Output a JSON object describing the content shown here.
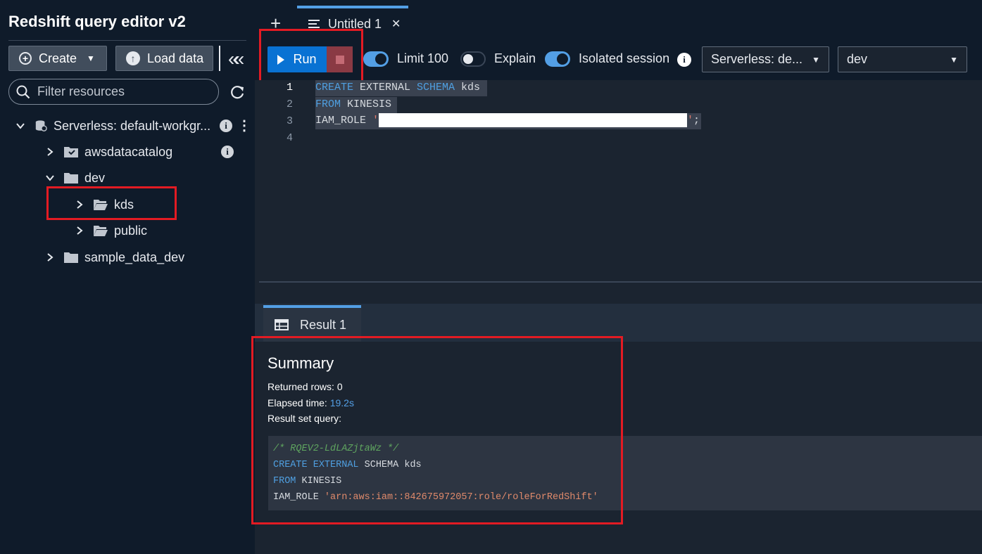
{
  "sidebar": {
    "title": "Redshift query editor v2",
    "create_label": "Create",
    "load_label": "Load data",
    "filter_placeholder": "Filter resources",
    "tree": {
      "workgroup": "Serverless: default-workgr...",
      "awsdatacatalog": "awsdatacatalog",
      "dev": "dev",
      "kds": "kds",
      "public": "public",
      "sample_data_dev": "sample_data_dev"
    }
  },
  "tabs": {
    "untitled": "Untitled 1"
  },
  "toolbar": {
    "run_label": "Run",
    "limit_label": "Limit 100",
    "limit_on": true,
    "explain_label": "Explain",
    "explain_on": false,
    "isolated_label": "Isolated session",
    "isolated_on": true,
    "connection_select": "Serverless: de...",
    "database_select": "dev"
  },
  "editor": {
    "line_numbers": [
      "1",
      "2",
      "3",
      "4"
    ],
    "line1_kw1": "CREATE",
    "line1_plain": " EXTERNAL ",
    "line1_kw2": "SCHEMA",
    "line1_name": " kds",
    "line2_kw": "FROM",
    "line2_plain": " KINESIS",
    "line3_plain": "IAM_ROLE ",
    "line3_quote_open": "'",
    "line3_quote_close": "'",
    "line3_end": ";"
  },
  "results": {
    "tab_label": "Result 1",
    "summary_title": "Summary",
    "returned_rows_label": "Returned rows: 0",
    "elapsed_label": "Elapsed time: ",
    "elapsed_value": "19.2s",
    "result_set_label": "Result set query:",
    "query": {
      "comment": "/* RQEV2-LdLAZjtaWz */",
      "l2_kw1": "CREATE",
      "l2_kw2": "EXTERNAL",
      "l2_rest": " SCHEMA kds",
      "l3_kw": "FROM",
      "l3_rest": " KINESIS",
      "l4_plain": "IAM_ROLE ",
      "l4_str": "'arn:aws:iam::842675972057:role/roleForRedShift'"
    }
  },
  "colors": {
    "accent": "#539fe5",
    "run_button": "#0972d3",
    "highlight_box": "#e31b23",
    "background": "#0f1b2a"
  }
}
